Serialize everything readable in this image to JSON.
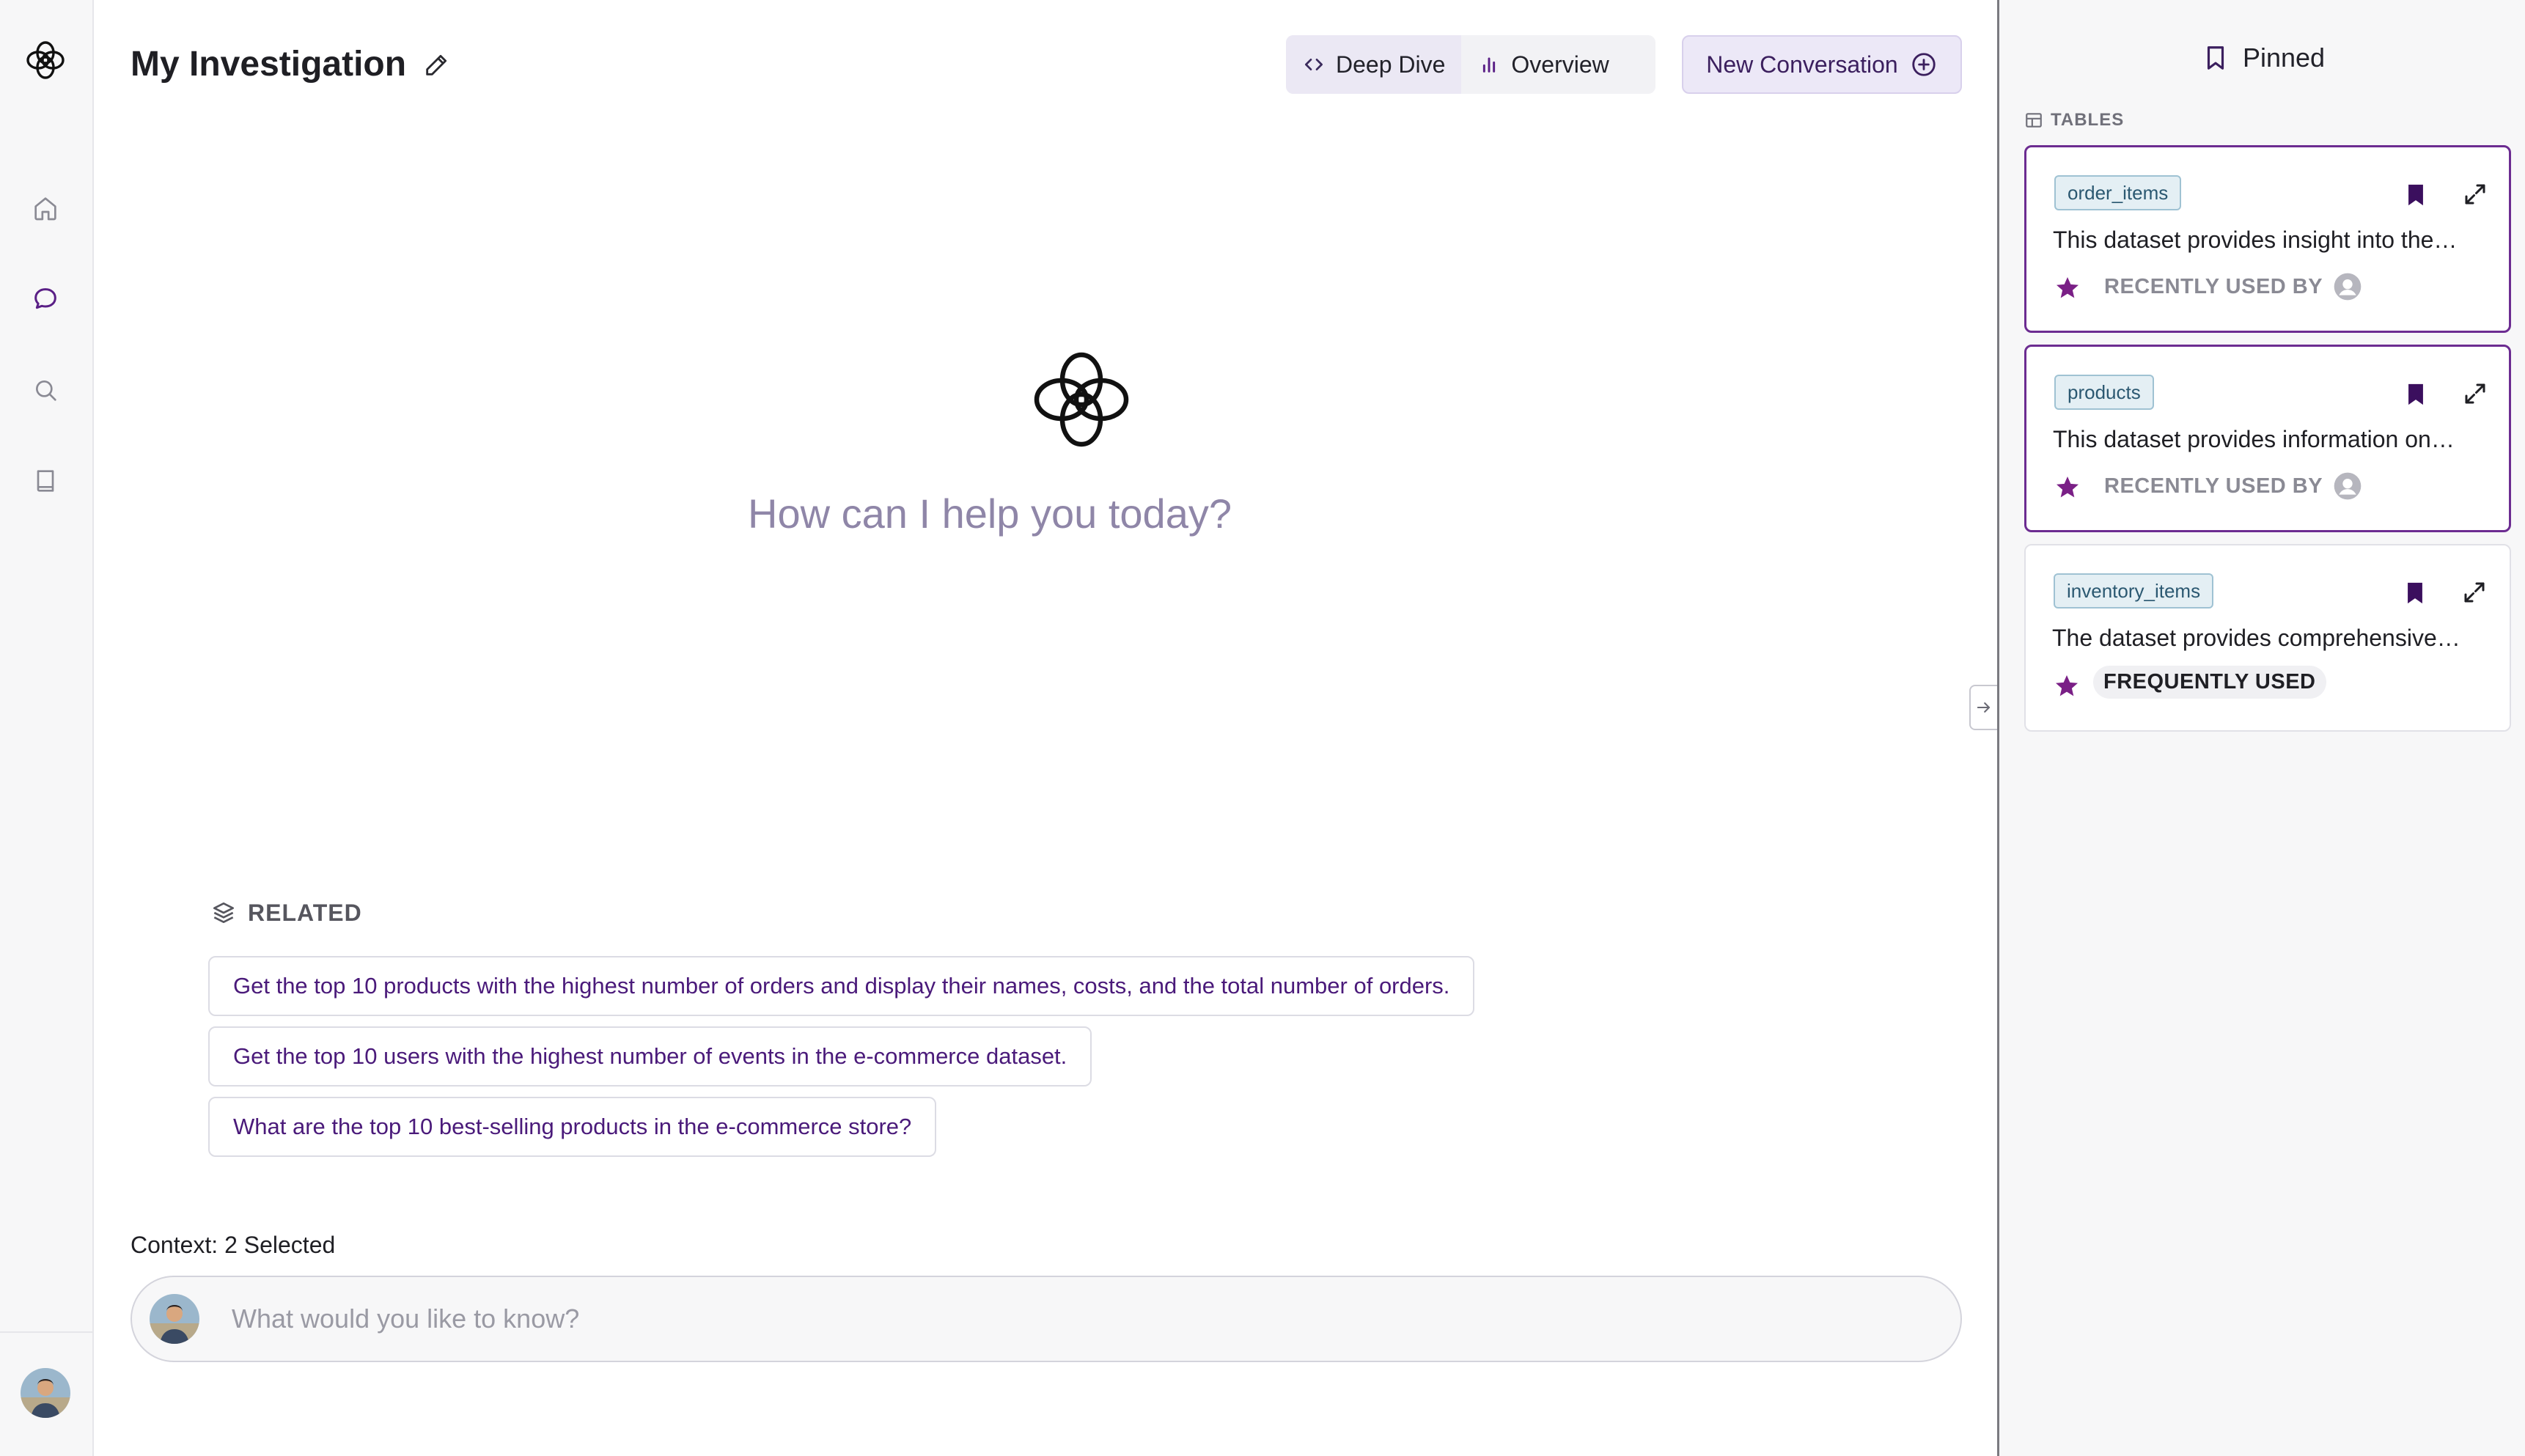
{
  "app": {
    "title": "My Investigation"
  },
  "nav": {
    "items": [
      {
        "name": "home",
        "icon": "home-icon"
      },
      {
        "name": "chat",
        "icon": "chat-icon",
        "active": true
      },
      {
        "name": "search",
        "icon": "search-icon"
      },
      {
        "name": "library",
        "icon": "book-icon"
      }
    ]
  },
  "toolbar": {
    "deep_dive_label": "Deep Dive",
    "overview_label": "Overview",
    "new_conversation_label": "New Conversation"
  },
  "hero": {
    "prompt": "How can I help you today?"
  },
  "related": {
    "heading": "RELATED",
    "suggestions": [
      "Get the top 10 products with the highest number of orders and display their names, costs, and the total number of orders.",
      "Get the top 10 users with the highest number of events in the e-commerce dataset.",
      "What are the top 10 best-selling products in the e-commerce store?"
    ]
  },
  "composer": {
    "context_label": "Context: 2 Selected",
    "placeholder": "What would you like to know?"
  },
  "pinned": {
    "title": "Pinned",
    "section_label": "TABLES",
    "cards": [
      {
        "tag": "order_items",
        "description": "This dataset provides insight into the…",
        "usage": "RECENTLY USED BY",
        "selected": true
      },
      {
        "tag": "products",
        "description": "This dataset provides information on…",
        "usage": "RECENTLY USED BY",
        "selected": true
      },
      {
        "tag": "inventory_items",
        "description": "The dataset provides comprehensive…",
        "usage": "FREQUENTLY USED",
        "selected": false
      }
    ]
  },
  "colors": {
    "accent": "#6c2c91",
    "suggestion_text": "#4a1a7a",
    "hero_text": "#8f86a8",
    "tag_bg": "#e4eff4"
  }
}
